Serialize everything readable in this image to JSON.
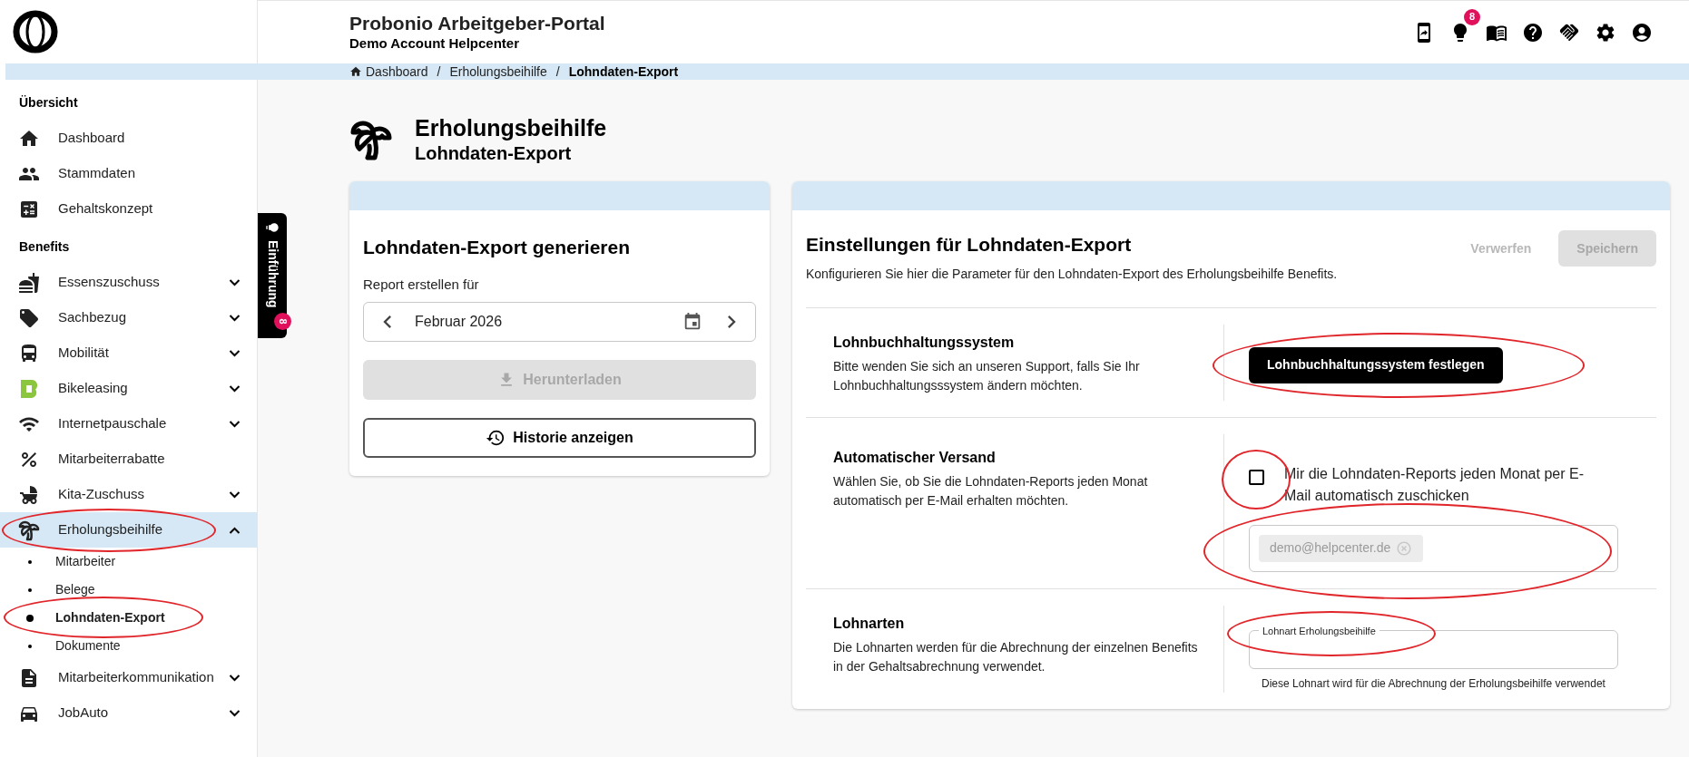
{
  "header": {
    "title": "Probonio Arbeitgeber-Portal",
    "subtitle": "Demo Account Helpcenter",
    "notification_count": "8"
  },
  "breadcrumb": [
    {
      "label": "Dashboard",
      "current": false
    },
    {
      "separator": "/",
      "label": "Erholungsbeihilfe",
      "current": false
    },
    {
      "separator": "/",
      "label": "Lohndaten-Export",
      "current": true
    }
  ],
  "sidebar": {
    "sections": [
      {
        "heading": "Übersicht",
        "items": [
          {
            "label": "Dashboard",
            "expandable": false,
            "selected": false,
            "highlighted": false
          },
          {
            "label": "Stammdaten",
            "expandable": false,
            "selected": false,
            "highlighted": false
          },
          {
            "label": "Gehaltskonzept",
            "expandable": false,
            "selected": false,
            "highlighted": false
          }
        ]
      },
      {
        "heading": "Benefits",
        "items": [
          {
            "label": "Essenszuschuss",
            "expandable": true,
            "expanded": false,
            "selected": false,
            "highlighted": false
          },
          {
            "label": "Sachbezug",
            "expandable": true,
            "expanded": false,
            "selected": false,
            "highlighted": false
          },
          {
            "label": "Mobilität",
            "expandable": true,
            "expanded": false,
            "selected": false,
            "highlighted": false
          },
          {
            "label": "Bikeleasing",
            "expandable": true,
            "expanded": false,
            "selected": false,
            "highlighted": false
          },
          {
            "label": "Internetpauschale",
            "expandable": true,
            "expanded": false,
            "selected": false,
            "highlighted": false
          },
          {
            "label": "Mitarbeiterrabatte",
            "expandable": false,
            "selected": false,
            "highlighted": false
          },
          {
            "label": "Kita-Zuschuss",
            "expandable": true,
            "expanded": false,
            "selected": false,
            "highlighted": false
          },
          {
            "label": "Erholungsbeihilfe",
            "expandable": true,
            "expanded": true,
            "selected": true,
            "highlighted": true,
            "children": [
              {
                "label": "Mitarbeiter",
                "selected": false,
                "highlighted": false
              },
              {
                "label": "Belege",
                "selected": false,
                "highlighted": false
              },
              {
                "label": "Lohndaten-Export",
                "selected": true,
                "highlighted": true
              },
              {
                "label": "Dokumente",
                "selected": false,
                "highlighted": false
              }
            ]
          },
          {
            "label": "Mitarbeiterkommunikation",
            "expandable": true,
            "expanded": false,
            "selected": false,
            "highlighted": false
          },
          {
            "label": "JobAuto",
            "expandable": true,
            "expanded": false,
            "selected": false,
            "highlighted": false
          }
        ]
      }
    ]
  },
  "tour_tab": {
    "label": "Einführung",
    "count": "8"
  },
  "page": {
    "title": "Erholungsbeihilfe",
    "subtitle": "Lohndaten-Export"
  },
  "export_card": {
    "title": "Lohndaten-Export generieren",
    "field_label": "Report erstellen für",
    "month": "Februar 2026",
    "download_button": {
      "label": "Herunterladen",
      "disabled": true
    },
    "history_button": "Historie anzeigen"
  },
  "settings_card": {
    "title": "Einstellungen für Lohndaten-Export",
    "description": "Konfigurieren Sie hier die Parameter für den Lohndaten-Export des Erholungsbeihilfe Benefits.",
    "discard_button": {
      "label": "Verwerfen",
      "disabled": true
    },
    "save_button": {
      "label": "Speichern",
      "disabled": true
    },
    "sections": [
      {
        "kind": "button",
        "title": "Lohnbuchhaltungssystem",
        "description": "Bitte wenden Sie sich an unseren Support, falls Sie Ihr Lohnbuchhaltungsssystem ändern möchten.",
        "button_label": "Lohnbuchhaltungssystem festlegen",
        "highlighted": true
      },
      {
        "kind": "auto_send",
        "title": "Automatischer Versand",
        "description": "Wählen Sie, ob Sie die Lohndaten-Reports jeden Monat automatisch per E-Mail erhalten möchten.",
        "checkbox": {
          "label": "Mir die Lohndaten-Reports jeden Monat per E-Mail automatisch zuschicken",
          "checked": false,
          "highlighted": true
        },
        "email_chip": "demo@helpcenter.de",
        "email_field_highlighted": true
      },
      {
        "kind": "select",
        "title": "Lohnarten",
        "description": "Die Lohnarten werden für die Abrechnung der einzelnen Benefits in der Gehaltsabrechnung verwendet.",
        "field_label": "Lohnart Erholungsbeihilfe",
        "helper": "Diese Lohnart wird für die Abrechnung der Erholungsbeihilfe verwendet",
        "highlighted": true
      }
    ]
  }
}
